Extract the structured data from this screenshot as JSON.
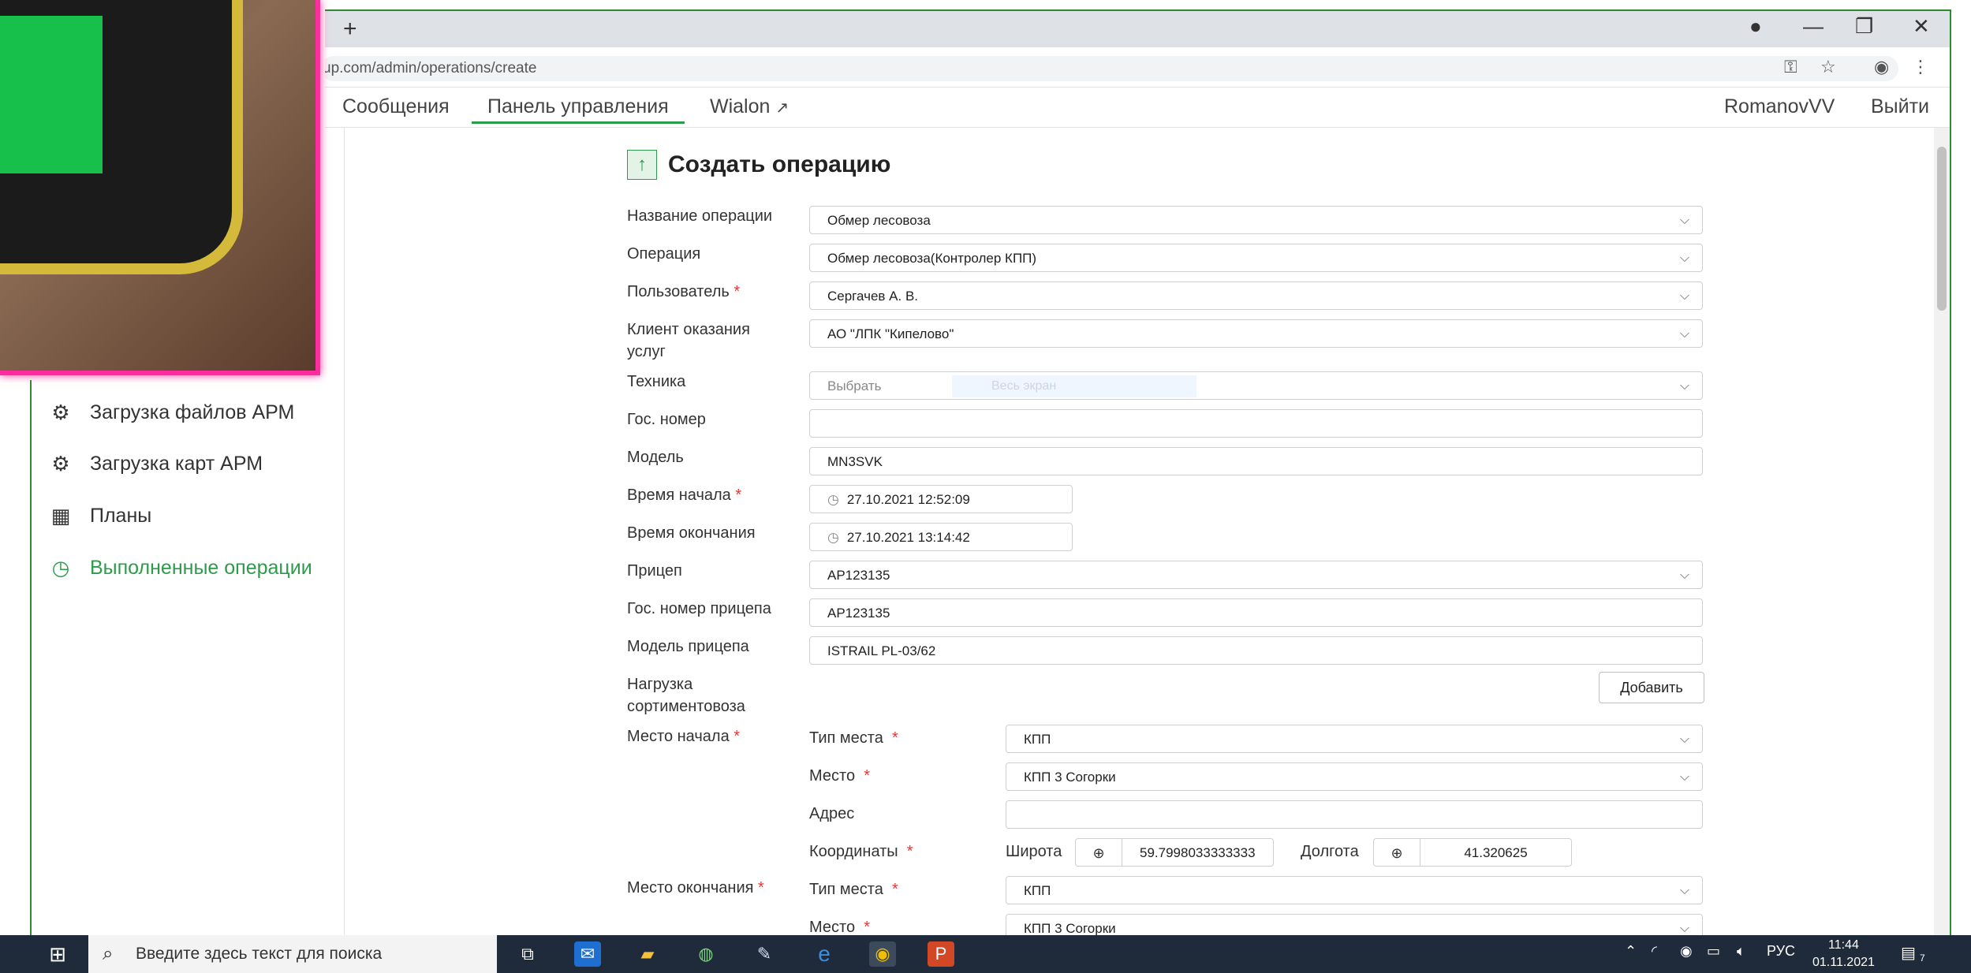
{
  "browser": {
    "url": "up.com/admin/operations/create",
    "newtab_label": "+",
    "minimize": "—",
    "restore": "❐",
    "close": "✕"
  },
  "nav": {
    "links": [
      {
        "label": "Сообщения"
      },
      {
        "label": "Панель управления",
        "active": true
      },
      {
        "label": "Wialon"
      }
    ],
    "user": "RomanovVV",
    "logout": "Выйти"
  },
  "sidebar": {
    "items": [
      {
        "label": "Загрузка файлов АРМ",
        "icon": "gear-icon"
      },
      {
        "label": "Загрузка карт АРМ",
        "icon": "gear-icon"
      },
      {
        "label": "Планы",
        "icon": "calendar-icon"
      },
      {
        "label": "Выполненные операции",
        "icon": "clock-icon",
        "active": true
      }
    ]
  },
  "overlay": {
    "label": "Весь экран"
  },
  "form": {
    "title": "Создать операцию",
    "fields": {
      "op_name": {
        "label": "Название операции",
        "value": "Обмер лесовоза"
      },
      "operation": {
        "label": "Операция",
        "value": "Обмер лесовоза(Контролер КПП)"
      },
      "user": {
        "label": "Пользователь",
        "value": "Сергачев  А. В."
      },
      "client": {
        "label": "Клиент оказания услуг",
        "value": "АО \"ЛПК \"Кипелово\""
      },
      "technique": {
        "label": "Техника",
        "placeholder": "Выбрать"
      },
      "gos_number": {
        "label": "Гос. номер",
        "value": ""
      },
      "model": {
        "label": "Модель",
        "value": "MN3SVK"
      },
      "start_time": {
        "label": "Время начала",
        "value": "27.10.2021 12:52:09"
      },
      "end_time": {
        "label": "Время окончания",
        "value": "27.10.2021 13:14:42"
      },
      "trailer": {
        "label": "Прицеп",
        "value": "АР123135"
      },
      "trailer_gos": {
        "label": "Гос. номер прицепа",
        "value": "АР123135"
      },
      "trailer_model": {
        "label": "Модель прицепа",
        "value": "ISTRAIL PL-03/62"
      },
      "load": {
        "label": "Нагрузка сортиментовоза",
        "button": "Добавить"
      }
    },
    "start_place": {
      "label": "Место начала",
      "type_label": "Тип места",
      "type_value": "КПП",
      "place_label": "Место",
      "place_value": "КПП 3 Согорки",
      "address_label": "Адрес",
      "address_value": "",
      "coords_label": "Координаты",
      "lat_label": "Широта",
      "lat_value": "59.7998033333333",
      "lon_label": "Долгота",
      "lon_value": "41.320625"
    },
    "end_place": {
      "label": "Место окончания",
      "type_label": "Тип места",
      "type_value": "КПП",
      "place_label": "Место",
      "place_value": "КПП 3 Согорки"
    },
    "required_mark": "*"
  },
  "taskbar": {
    "search_placeholder": "Введите здесь текст для поиска",
    "lang": "РУС",
    "time": "11:44",
    "date": "01.11.2021",
    "notifications": "7"
  }
}
